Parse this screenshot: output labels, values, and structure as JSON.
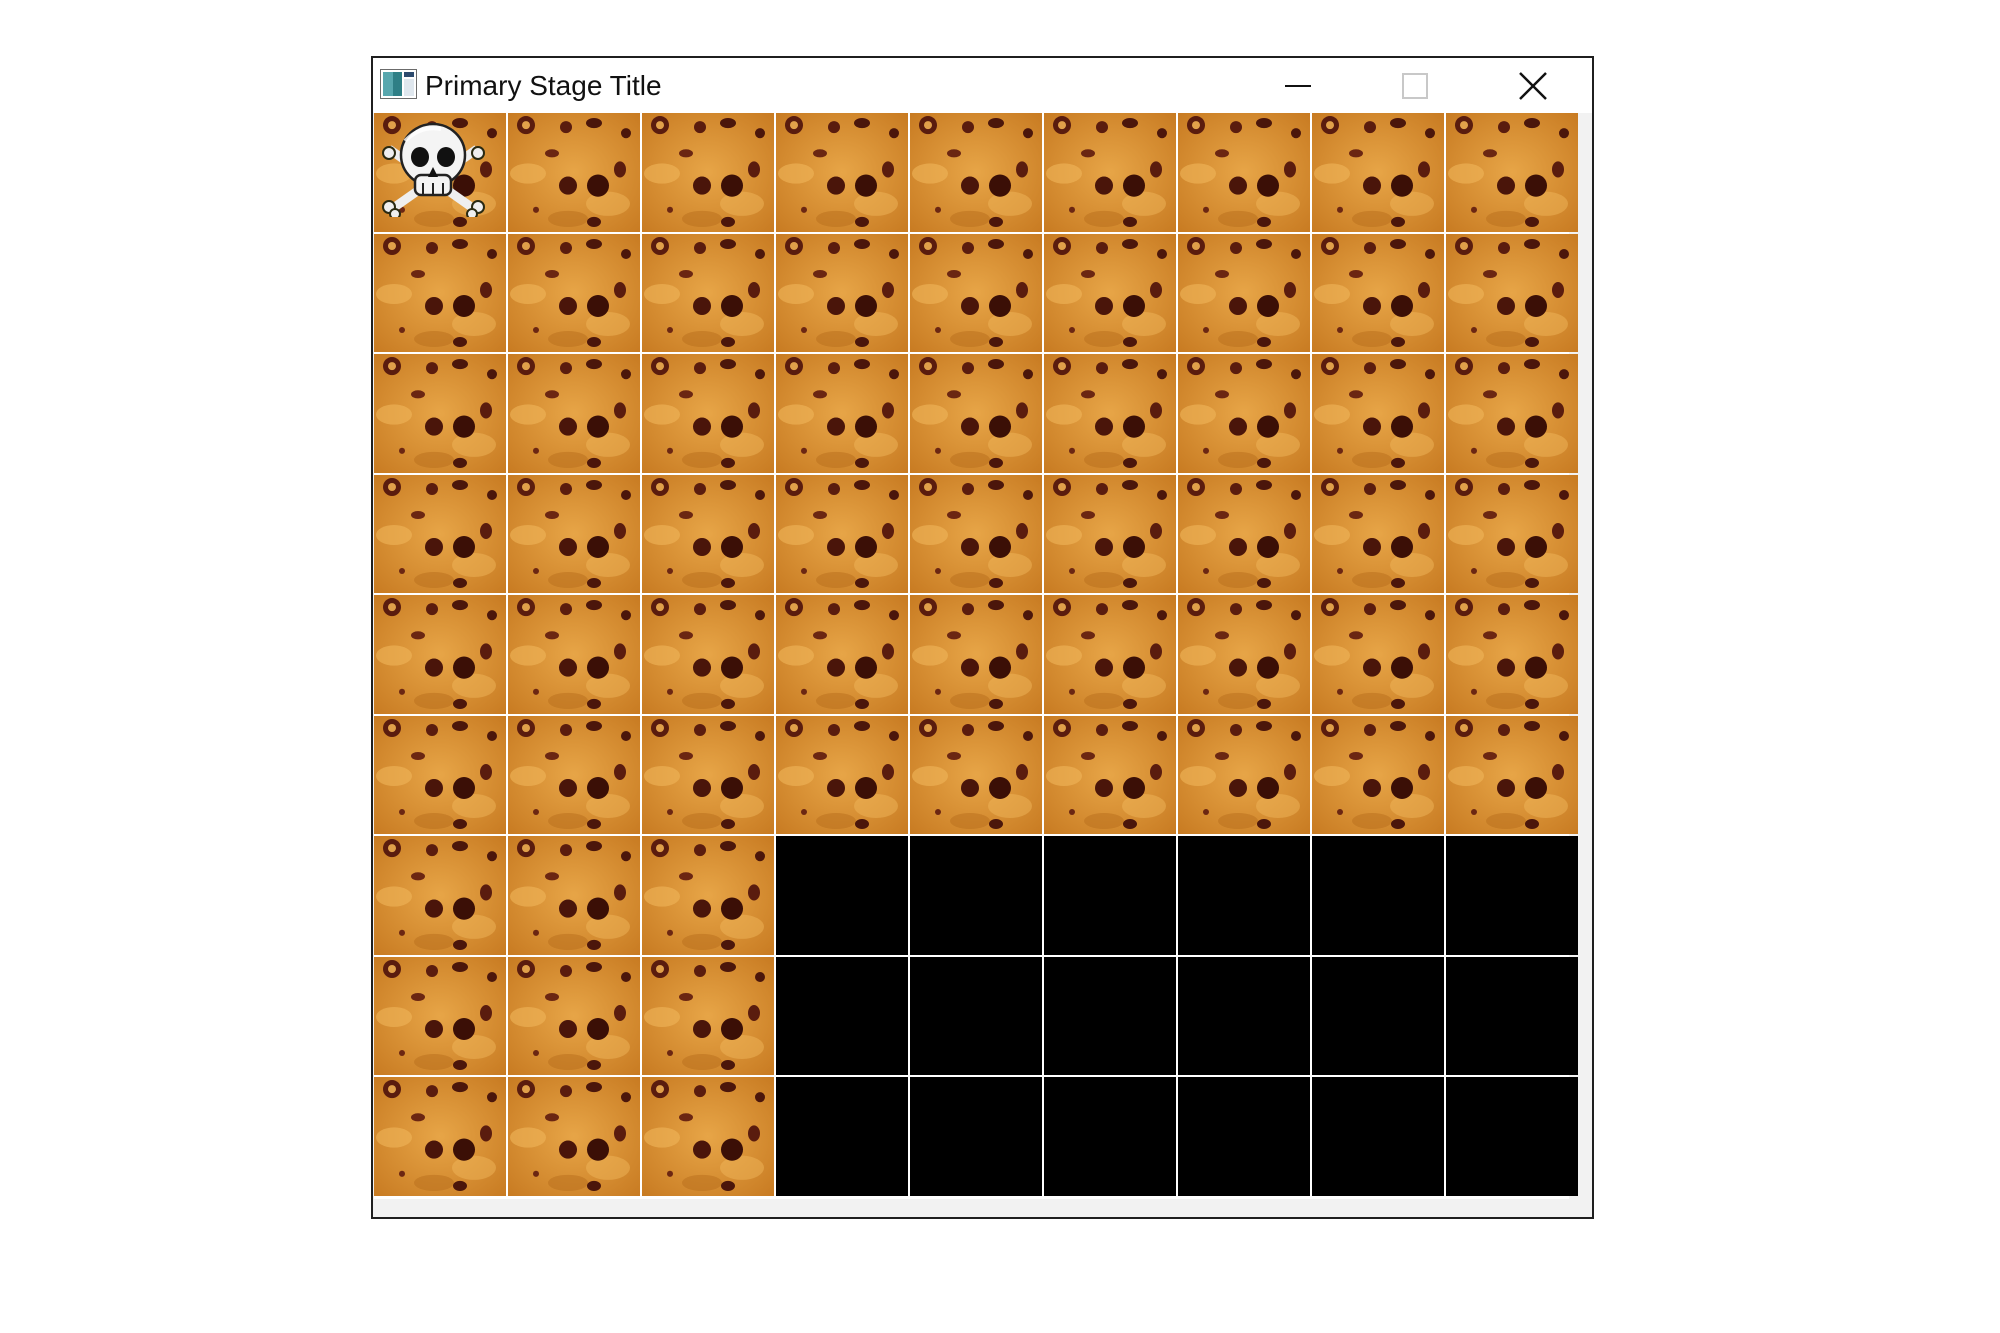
{
  "window": {
    "title": "Primary Stage Title",
    "controls": {
      "minimize_icon": "minimize-icon",
      "maximize_icon": "maximize-icon",
      "close_icon": "close-icon"
    }
  },
  "board": {
    "rows": 9,
    "cols": 9,
    "tile_texture": "cookie-texture",
    "mine_icon": "skull-crossbones-icon",
    "colors": {
      "covered_tile": "#d99232",
      "revealed_tile": "#000000",
      "grid_line": "#ffffff",
      "selected_outline": "#9ec3d8"
    },
    "grid": [
      [
        "mine",
        "covered",
        "covered",
        "covered",
        "covered",
        "covered",
        "covered",
        "covered",
        "covered"
      ],
      [
        "covered",
        "covered",
        "covered",
        "covered",
        "covered",
        "covered",
        "covered",
        "covered",
        "covered"
      ],
      [
        "covered",
        "covered",
        "covered",
        "covered",
        "covered",
        "covered",
        "covered",
        "covered",
        "covered"
      ],
      [
        "covered",
        "covered",
        "covered",
        "covered",
        "covered",
        "covered",
        "covered",
        "covered",
        "covered"
      ],
      [
        "covered",
        "covered",
        "covered",
        "covered",
        "covered",
        "covered",
        "covered",
        "covered",
        "covered"
      ],
      [
        "covered",
        "covered",
        "covered",
        "covered",
        "covered",
        "covered",
        "covered",
        "covered",
        "covered"
      ],
      [
        "covered",
        "covered",
        "covered",
        "revealed",
        "revealed",
        "revealed",
        "revealed",
        "revealed",
        "revealed"
      ],
      [
        "covered",
        "covered",
        "covered",
        "revealed",
        "revealed",
        "revealed",
        "revealed",
        "revealed",
        "revealed"
      ],
      [
        "covered",
        "covered",
        "covered",
        "revealed",
        "revealed",
        "revealed",
        "revealed",
        "revealed",
        "revealed"
      ]
    ],
    "selected_cell": {
      "row": 6,
      "col": 2
    }
  }
}
